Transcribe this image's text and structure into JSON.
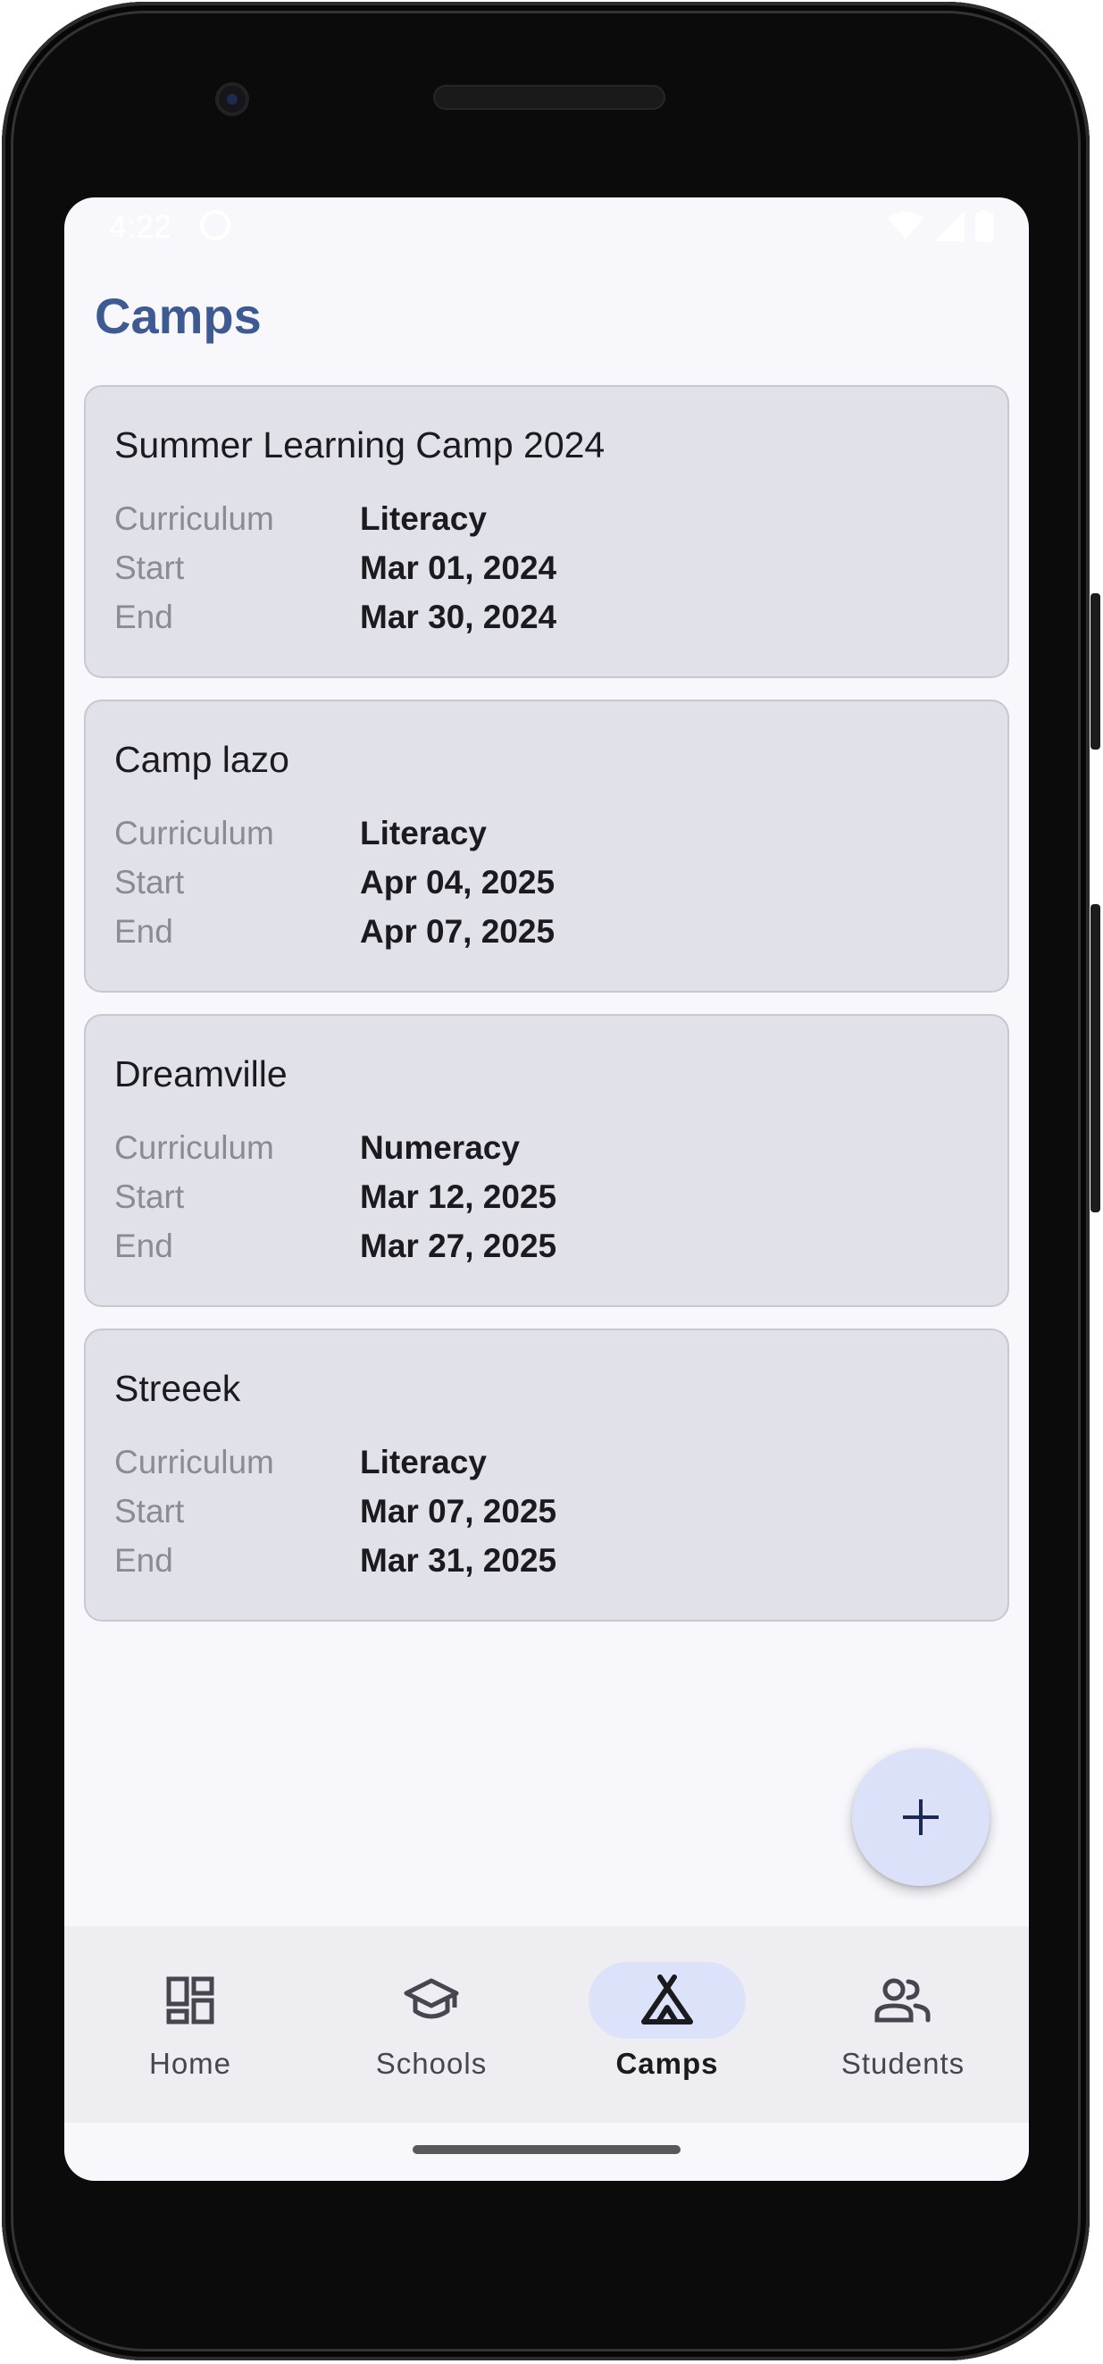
{
  "status_bar": {
    "time": "4:22",
    "icons": [
      "app-notification-icon",
      "wifi-icon",
      "cellular-signal-icon",
      "battery-icon"
    ]
  },
  "page": {
    "title": "Camps"
  },
  "camps": [
    {
      "name": "Summer Learning Camp 2024",
      "curriculum_label": "Curriculum",
      "curriculum": "Literacy",
      "start_label": "Start",
      "start": "Mar 01, 2024",
      "end_label": "End",
      "end": "Mar 30, 2024"
    },
    {
      "name": "Camp lazo",
      "curriculum_label": "Curriculum",
      "curriculum": "Literacy",
      "start_label": "Start",
      "start": "Apr 04, 2025",
      "end_label": "End",
      "end": "Apr 07, 2025"
    },
    {
      "name": "Dreamville",
      "curriculum_label": "Curriculum",
      "curriculum": "Numeracy",
      "start_label": "Start",
      "start": "Mar 12, 2025",
      "end_label": "End",
      "end": "Mar 27, 2025"
    },
    {
      "name": "Streeek",
      "curriculum_label": "Curriculum",
      "curriculum": "Literacy",
      "start_label": "Start",
      "start": "Mar 07, 2025",
      "end_label": "End",
      "end": "Mar 31, 2025"
    }
  ],
  "fab": {
    "icon": "plus-icon"
  },
  "nav": {
    "active": "Camps",
    "items": [
      {
        "label": "Home",
        "icon": "dashboard-icon"
      },
      {
        "label": "Schools",
        "icon": "school-icon"
      },
      {
        "label": "Camps",
        "icon": "tent-icon"
      },
      {
        "label": "Students",
        "icon": "people-icon"
      }
    ]
  },
  "colors": {
    "title": "#3d5a93",
    "card_background": "#e1e1ea",
    "screen_background": "#f8f7fc",
    "fab_background": "#dbe1f9",
    "nav_active_pill": "#dce2f9",
    "nav_background": "#eeedf2"
  }
}
